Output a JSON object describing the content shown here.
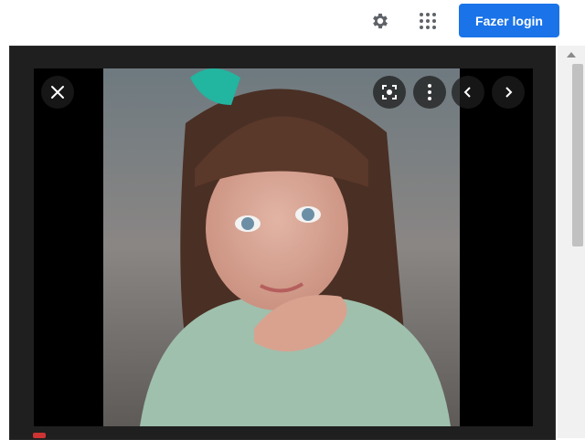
{
  "header": {
    "settings_icon": "gear-icon",
    "apps_icon": "apps-grid-icon",
    "login_label": "Fazer login",
    "login_color": "#1a73e8"
  },
  "viewer": {
    "close_icon": "close-icon",
    "lens_icon": "lens-search-icon",
    "more_icon": "more-vert-icon",
    "prev_icon": "chevron-left-icon",
    "next_icon": "chevron-right-icon",
    "image_subject": "girl-portrait-photo"
  }
}
